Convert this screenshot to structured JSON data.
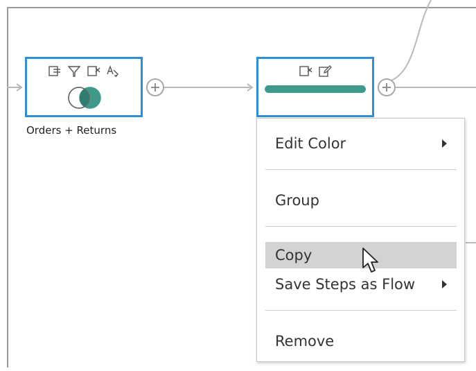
{
  "flow": {
    "join_step": {
      "caption": "Orders + Returns",
      "icons": [
        "filter-list-icon",
        "filter-icon",
        "remove-field-icon",
        "rename-field-icon"
      ],
      "venn_icon": "inner-join-icon"
    },
    "clean_step": {
      "icons": [
        "remove-field-icon",
        "edit-icon"
      ],
      "color": "#3f9a8c"
    },
    "accent_color": "#2f8fd5"
  },
  "context_menu": {
    "items": [
      {
        "label": "Edit Color",
        "has_submenu": true
      },
      {
        "label": "Group",
        "has_submenu": false
      },
      {
        "label": "Copy",
        "has_submenu": false,
        "hovered": true
      },
      {
        "label": "Save Steps as Flow",
        "has_submenu": true
      },
      {
        "label": "Remove",
        "has_submenu": false
      }
    ]
  }
}
